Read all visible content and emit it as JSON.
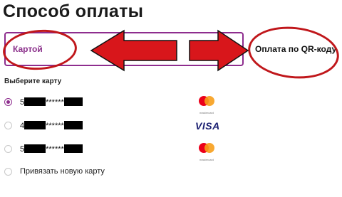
{
  "page": {
    "title": "Способ оплаты"
  },
  "tabs": [
    {
      "label": "Картой",
      "selected": true
    },
    {
      "label": "Оплата по QR-коду",
      "selected": false
    }
  ],
  "cards_section": {
    "title": "Выберите карту"
  },
  "cards": [
    {
      "prefix": "5",
      "mask": "******",
      "brand": "mastercard",
      "brand_caption": "mastercard",
      "selected": true
    },
    {
      "prefix": "4",
      "mask": "******",
      "brand": "visa",
      "brand_caption": "VISA",
      "selected": false
    },
    {
      "prefix": "5",
      "mask": "******",
      "brand": "mastercard",
      "brand_caption": "mastercard",
      "selected": false
    }
  ],
  "add_card": {
    "label": "Привязать новую карту"
  },
  "colors": {
    "accent": "#8e2d8e",
    "annotation": "#d8161b",
    "mc_red": "#eb001b",
    "mc_orange": "#f79e1b",
    "visa_blue": "#1a1f71"
  }
}
